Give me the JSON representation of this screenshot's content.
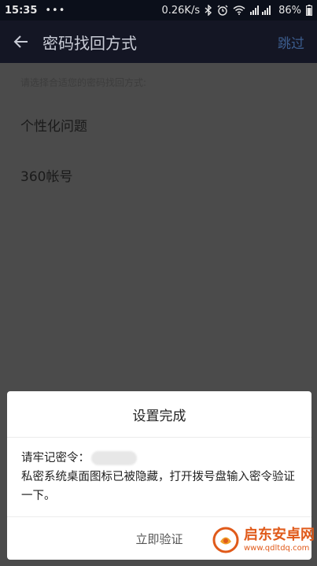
{
  "status_bar": {
    "time": "15:35",
    "menu_dots": "•••",
    "speed": "0.26K/s",
    "battery": "86%",
    "icons": [
      "bluetooth-icon",
      "alarm-icon",
      "wifi-icon",
      "signal-icon",
      "battery-icon"
    ]
  },
  "app_bar": {
    "title": "密码找回方式",
    "skip_label": "跳过"
  },
  "content": {
    "hint": "请选择合适您的密码找回方式:",
    "options": [
      {
        "label": "个性化问题"
      },
      {
        "label": "360帐号"
      }
    ]
  },
  "dialog": {
    "title": "设置完成",
    "password_prefix": "请牢记密令：",
    "message": "私密系统桌面图标已被隐藏，打开拨号盘输入密令验证一下。",
    "verify_label": "立即验证"
  },
  "watermark": {
    "name": "启东安卓网",
    "url": "www.qdltdq.com"
  },
  "colors": {
    "status_bg": "#0b0f1a",
    "appbar_bg": "#141624",
    "skip": "#3c5d8e",
    "watermark": "#e05a1a"
  }
}
